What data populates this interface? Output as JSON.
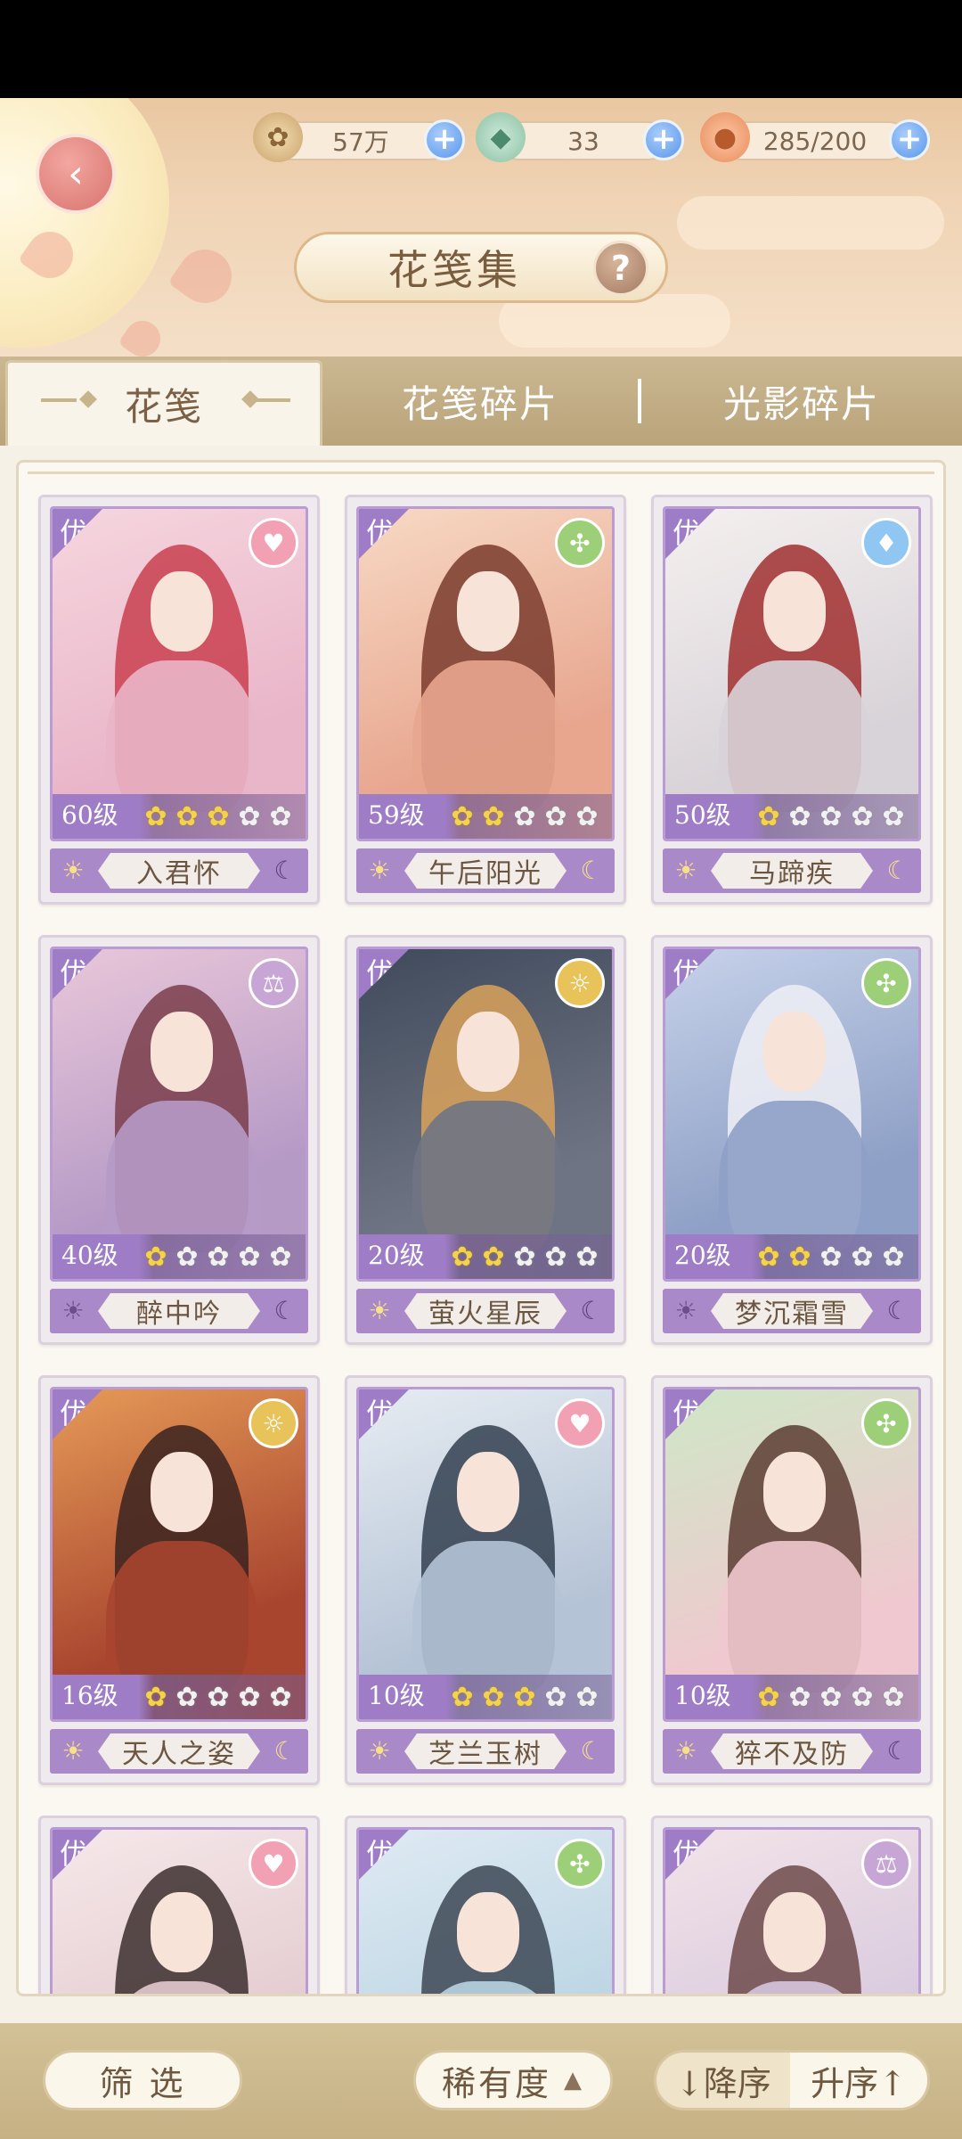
{
  "resources": [
    {
      "icon": "paw-coin-icon",
      "value": "57万"
    },
    {
      "icon": "jade-dragon-icon",
      "value": "33"
    },
    {
      "icon": "peach-stamina-icon",
      "value": "285/200"
    }
  ],
  "header": {
    "title": "花笺集",
    "help_glyph": "?",
    "back_glyph": "‹"
  },
  "tabs": [
    {
      "label": "花笺",
      "active": true
    },
    {
      "label": "花笺碎片",
      "active": false
    },
    {
      "label": "光影碎片",
      "active": false
    }
  ],
  "cards": [
    {
      "badge": "优",
      "level": "60级",
      "stars": 3,
      "name": "入君怀",
      "attr": "heart",
      "attr_color": "#f2a0b4"
    },
    {
      "badge": "优",
      "level": "59级",
      "stars": 2,
      "name": "午后阳光",
      "attr": "leaf",
      "attr_color": "#9ccf78"
    },
    {
      "badge": "优",
      "level": "50级",
      "stars": 1,
      "name": "马蹄疾",
      "attr": "water",
      "attr_color": "#8fc6f2"
    },
    {
      "badge": "优",
      "level": "40级",
      "stars": 1,
      "name": "醉中吟",
      "attr": "scale",
      "attr_color": "#c7a6d6"
    },
    {
      "badge": "优",
      "level": "20级",
      "stars": 2,
      "name": "萤火星辰",
      "attr": "lamp",
      "attr_color": "#e7c35a"
    },
    {
      "badge": "优",
      "level": "20级",
      "stars": 2,
      "name": "梦沉霜雪",
      "attr": "leaf",
      "attr_color": "#9ccf78"
    },
    {
      "badge": "优",
      "level": "16级",
      "stars": 1,
      "name": "天人之姿",
      "attr": "lamp",
      "attr_color": "#e7c35a"
    },
    {
      "badge": "优",
      "level": "10级",
      "stars": 3,
      "name": "芝兰玉树",
      "attr": "heart",
      "attr_color": "#f2a0b4"
    },
    {
      "badge": "优",
      "level": "10级",
      "stars": 1,
      "name": "猝不及防",
      "attr": "leaf",
      "attr_color": "#9ccf78"
    },
    {
      "badge": "优",
      "attr": "heart",
      "attr_color": "#f2a0b4"
    },
    {
      "badge": "优",
      "attr": "leaf",
      "attr_color": "#9ccf78"
    },
    {
      "badge": "优",
      "attr": "scale",
      "attr_color": "#c7a6d6"
    }
  ],
  "bottom": {
    "filter_label": "筛 选",
    "rarity_label": "稀有度",
    "desc_label": "↓降序",
    "asc_label": "升序↑"
  },
  "colors": {
    "accent_purple": "#9f7cc6",
    "star_on": "#f3d24c",
    "tab_bar": "#c0ab82"
  }
}
